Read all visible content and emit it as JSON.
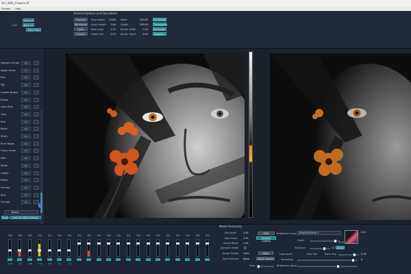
{
  "window": {
    "title": "Girl_With_Flowers.tif"
  },
  "menu": [
    "Presets",
    "Help"
  ],
  "top_left": {
    "buttons": [
      {
        "label": "Front LE"
      },
      {
        "label": "Back LE"
      },
      {
        "label": "Slice View"
      }
    ],
    "value": "1.00"
  },
  "general": {
    "title": "General Options and Operations",
    "buttons": [
      {
        "label": "Reorient"
      },
      {
        "label": "Wireframe"
      },
      {
        "label": "Reset View"
      },
      {
        "label": "Smooth"
      }
    ],
    "opts": [
      {
        "label": "Step Height",
        "value": "0.040"
      },
      {
        "label": "Layer Height",
        "value": "0.46"
      },
      {
        "label": "Base Layer",
        "value": "0.15"
      },
      {
        "label": "Detail Size",
        "value": "0.15"
      }
    ],
    "dims": [
      {
        "label": "Width",
        "value": "200.00"
      },
      {
        "label": "Height",
        "value": "200.00"
      },
      {
        "label": "Border Width",
        "value": "0.00"
      },
      {
        "label": "Border Depth",
        "value": "0.00"
      }
    ],
    "toggles": [
      {
        "label": "Full Range"
      },
      {
        "label": "Transparent"
      },
      {
        "label": "No Border"
      },
      {
        "label": "Negative"
      }
    ]
  },
  "colors": {
    "items": [
      {
        "label": "Majestic Purple",
        "value": "0.0"
      },
      {
        "label": "Apple Green",
        "value": "0.1"
      },
      {
        "label": "Red",
        "value": "0.5"
      },
      {
        "label": "Tan",
        "value": "0.6"
      },
      {
        "label": "Coyote Brown",
        "value": "0.5"
      },
      {
        "label": "Brown",
        "value": "0.2"
      },
      {
        "label": "Light Blue",
        "value": "0.0"
      },
      {
        "label": "Gray",
        "value": "0.3"
      },
      {
        "label": "Red",
        "value": "0.0"
      },
      {
        "label": "Black",
        "value": "0.5"
      },
      {
        "label": "Silver",
        "value": "0.2"
      },
      {
        "label": "Pure Yellow",
        "value": "0.0"
      },
      {
        "label": "Grass Green",
        "value": "0.0"
      },
      {
        "label": "Skin",
        "value": "0.0"
      },
      {
        "label": "White",
        "value": "0.5"
      },
      {
        "label": "Coffee",
        "value": "0.0"
      },
      {
        "label": "Pastel",
        "value": "0.0"
      },
      {
        "label": "Fuchsia",
        "value": "0.0"
      },
      {
        "label": "Blue",
        "value": "0.5"
      },
      {
        "label": "Orange",
        "value": "0.0"
      }
    ],
    "brand_label": "Brand",
    "load_button": "Load set With Defaults",
    "explore_button": "Explore"
  },
  "mixer": {
    "values": [
      "0.5",
      "5.0",
      "4.0",
      "5.0",
      "3.1",
      "5.0",
      "3.5",
      "5.0",
      "5.0",
      "5.0",
      "5.0",
      "5.0",
      "5.0",
      "5.0",
      "5.0",
      "5.0",
      "5.0",
      "5.0",
      "5.0",
      "5.0",
      "5.0"
    ],
    "footers": [
      "0.72",
      "3.6",
      "1.66",
      "1.14",
      "2.5",
      "3.0",
      "3.4"
    ]
  },
  "model_geometry": {
    "title": "Model Geometry",
    "rows": [
      {
        "label": "Min Depth",
        "value": "0.46"
      },
      {
        "label": "Max Depth",
        "value": "2.56"
      },
      {
        "label": "Actual Depth",
        "value": "2.48"
      },
      {
        "label": "Dynamic Depth",
        "value": ""
      }
    ],
    "image_format_label": "Image Format",
    "image_format_value": "Color",
    "legacy_button": "Legacy",
    "spike_label": "Spike Remove",
    "spike_value": "None",
    "adjust_button": "Adjust Amount",
    "preview_buttons": [
      "4K64",
      "Ambient Lighting"
    ],
    "brightness_comp_label": "Brightness Comp",
    "brightness_comp_value": "Bright Enhance 4",
    "power_label": "Power",
    "power_value": "0.11",
    "tolerance_label": "Tolerance",
    "tolerance_value": "11",
    "reset_button": "Reset",
    "luminance_label": "Luminance",
    "color_pop_label": "Color Pop",
    "extra_gap_label": "Extra Gap",
    "extra_gap_value": "0.78",
    "smoothing_label": "Smoothing",
    "smoothing_value": "0",
    "time_label": "Time",
    "brightness_adjust_label": "Brightness Adjust",
    "right_value": "0.22"
  }
}
